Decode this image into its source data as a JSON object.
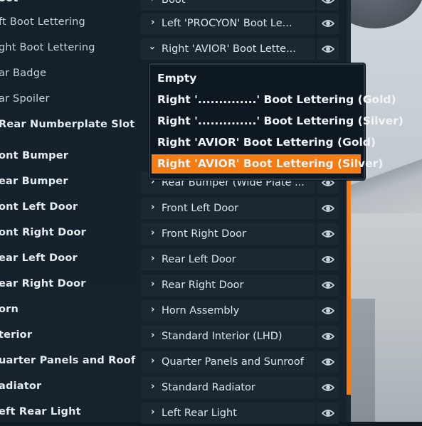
{
  "rows": [
    {
      "label": "oot",
      "value": "Boot"
    },
    {
      "label": "ft Boot Lettering",
      "value": "Left 'PROCYON' Boot Le..."
    },
    {
      "label": "ght Boot Lettering",
      "value": "Right 'AVIOR' Boot Lette..."
    },
    {
      "label": "ar Badge",
      "value": ""
    },
    {
      "label": "ar Spoiler",
      "value": ""
    },
    {
      "label": "Rear Numberplate Slot",
      "value": ""
    },
    {
      "label": "ont Bumper",
      "value": ""
    },
    {
      "label": "ear Bumper",
      "value": "Rear Bumper (Wide Plate ..."
    },
    {
      "label": "ont Left Door",
      "value": "Front Left Door"
    },
    {
      "label": "ont Right Door",
      "value": "Front Right Door"
    },
    {
      "label": "ear Left Door",
      "value": "Rear Left Door"
    },
    {
      "label": "ear Right Door",
      "value": "Rear Right Door"
    },
    {
      "label": "orn",
      "value": "Horn Assembly"
    },
    {
      "label": "terior",
      "value": "Standard Interior (LHD)"
    },
    {
      "label": "uarter Panels and Roof",
      "value": "Quarter Panels and Sunroof"
    },
    {
      "label": "adiator",
      "value": "Standard Radiator"
    },
    {
      "label": "eft Rear Light",
      "value": "Left Rear Light"
    }
  ],
  "dropdown": {
    "options": [
      "Empty",
      "Right '..............' Boot Lettering (Gold)",
      "Right '..............' Boot Lettering (Silver)",
      "Right 'AVIOR' Boot Lettering (Gold)",
      "Right 'AVIOR' Boot Lettering (Silver)"
    ],
    "selected_index": 4
  },
  "icons": {
    "chevron_collapsed": "chevron-right-icon",
    "chevron_expanded": "chevron-down-icon",
    "visibility": "eye-icon"
  },
  "colors": {
    "accent": "#f47c12",
    "panel": "#16232d",
    "selector": "#1b2731",
    "text": "#e6ecf0"
  }
}
